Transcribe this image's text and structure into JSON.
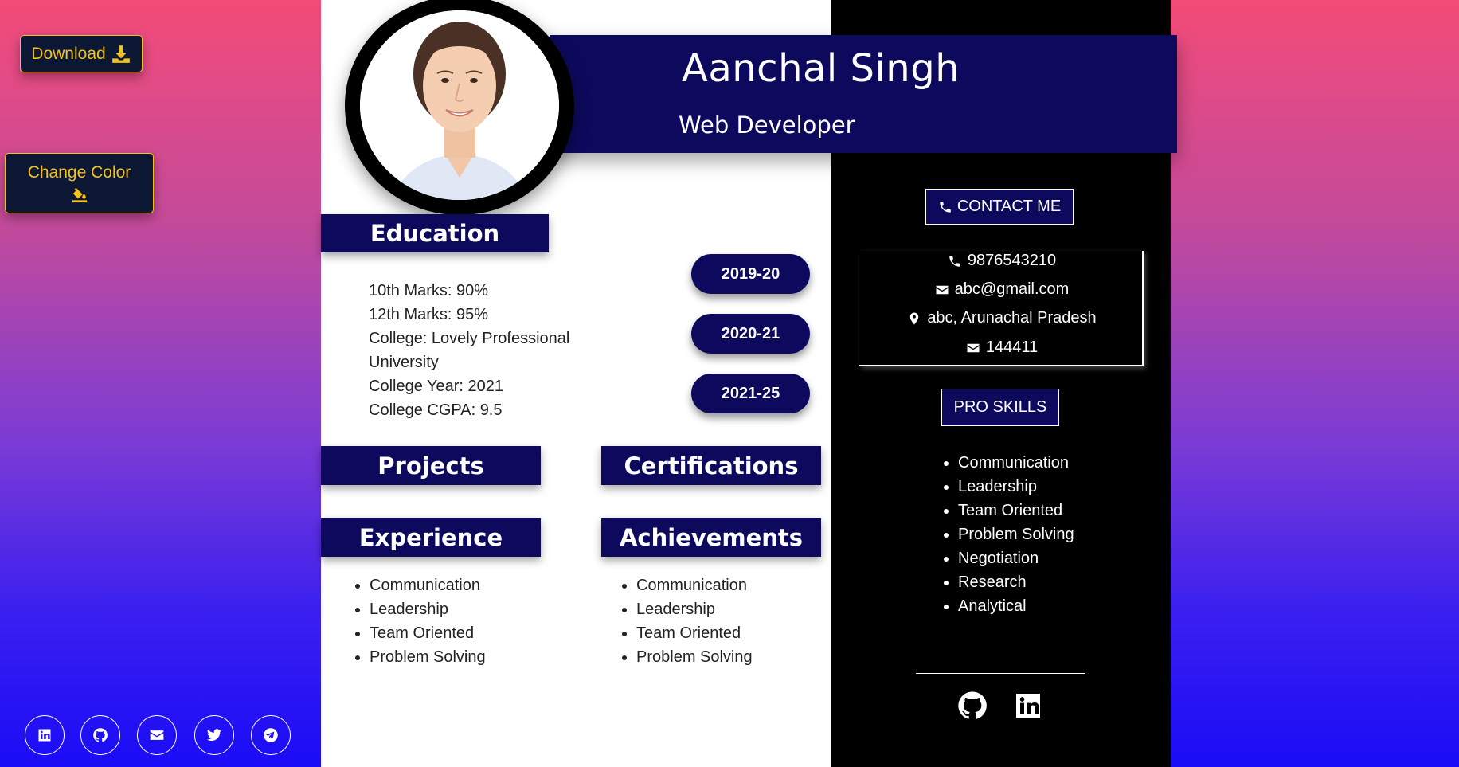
{
  "tools": {
    "download_label": "Download",
    "change_color_label": "Change Color"
  },
  "social_links": [
    "linkedin-icon",
    "github-icon",
    "envelope-icon",
    "twitter-icon",
    "telegram-icon"
  ],
  "header": {
    "name": "Aanchal Singh",
    "role": "Web Developer"
  },
  "education": {
    "title": "Education",
    "lines": [
      "10th Marks: 90%",
      "12th Marks: 95%",
      "College: Lovely Professional University",
      "College Year: 2021",
      "College CGPA: 9.5"
    ],
    "years": [
      "2019-20",
      "2020-21",
      "2021-25"
    ]
  },
  "sections": {
    "projects": "Projects",
    "certifications": "Certifications",
    "experience": "Experience",
    "achievements": "Achievements"
  },
  "experience_items": [
    "Communication",
    "Leadership",
    "Team Oriented",
    "Problem Solving"
  ],
  "achievement_items": [
    "Communication",
    "Leadership",
    "Team Oriented",
    "Problem Solving"
  ],
  "contact": {
    "title": "CONTACT ME",
    "phone": "9876543210",
    "email": "abc@gmail.com",
    "address": "abc, Arunachal Pradesh",
    "pin": "144411"
  },
  "skills": {
    "title": "PRO SKILLS",
    "items": [
      "Communication",
      "Leadership",
      "Team Oriented",
      "Problem Solving",
      "Negotiation",
      "Research",
      "Analytical"
    ]
  },
  "colors": {
    "navy": "#0d0a5e",
    "gold": "#f4c21a",
    "button_bg": "#0c1733"
  }
}
